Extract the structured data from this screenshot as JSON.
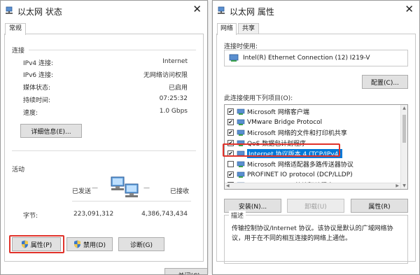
{
  "left_window": {
    "title": "以太网 状态",
    "tab_general": "常规",
    "connection": {
      "section_title": "连接",
      "rows": [
        {
          "label": "IPv4 连接:",
          "value": "Internet"
        },
        {
          "label": "IPv6 连接:",
          "value": "无网络访问权限"
        },
        {
          "label": "媒体状态:",
          "value": "已启用"
        },
        {
          "label": "持续时间:",
          "value": "07:25:32"
        },
        {
          "label": "速度:",
          "value": "1.0 Gbps"
        }
      ],
      "details_button": "详细信息(E)..."
    },
    "activity": {
      "section_title": "活动",
      "sent_label": "已发送",
      "received_label": "已接收",
      "bytes_label": "字节:",
      "bytes_sent": "223,091,312",
      "bytes_received": "4,386,743,434"
    },
    "buttons": {
      "properties": "属性(P)",
      "disable": "禁用(D)",
      "diagnose": "诊断(G)",
      "close": "关闭(C)"
    }
  },
  "right_window": {
    "title": "以太网 属性",
    "tab_network": "网络",
    "tab_sharing": "共享",
    "connect_using_label": "连接时使用:",
    "adapter_name": "Intel(R) Ethernet Connection (12) I219-V",
    "configure_button": "配置(C)...",
    "items_label": "此连接使用下列项目(O):",
    "items": [
      {
        "label": "Microsoft 网络客户端",
        "checked": true,
        "selected": false
      },
      {
        "label": "VMware Bridge Protocol",
        "checked": true,
        "selected": false
      },
      {
        "label": "Microsoft 网络的文件和打印机共享",
        "checked": true,
        "selected": false
      },
      {
        "label": "QoS 数据包计划程序",
        "checked": true,
        "selected": false
      },
      {
        "label": "Internet 协议版本 4 (TCP/IPv4)",
        "checked": true,
        "selected": true
      },
      {
        "label": "Microsoft 网络适配器多路传送器协议",
        "checked": false,
        "selected": false
      },
      {
        "label": "PROFINET IO protocol (DCP/LLDP)",
        "checked": true,
        "selected": false
      },
      {
        "label": "Microsoft LLDP 协议驱动程序",
        "checked": true,
        "selected": false
      }
    ],
    "install_button": "安装(N)...",
    "uninstall_button": "卸载(U)",
    "properties_button": "属性(R)",
    "description_label": "描述",
    "description_text": "传输控制协议/Internet 协议。该协议是默认的广域网络协议，用于在不同的相互连接的网络上通信。"
  },
  "colors": {
    "highlight": "#e0322a",
    "selection": "#0078d7",
    "button_bg": "#e1e1e1"
  }
}
